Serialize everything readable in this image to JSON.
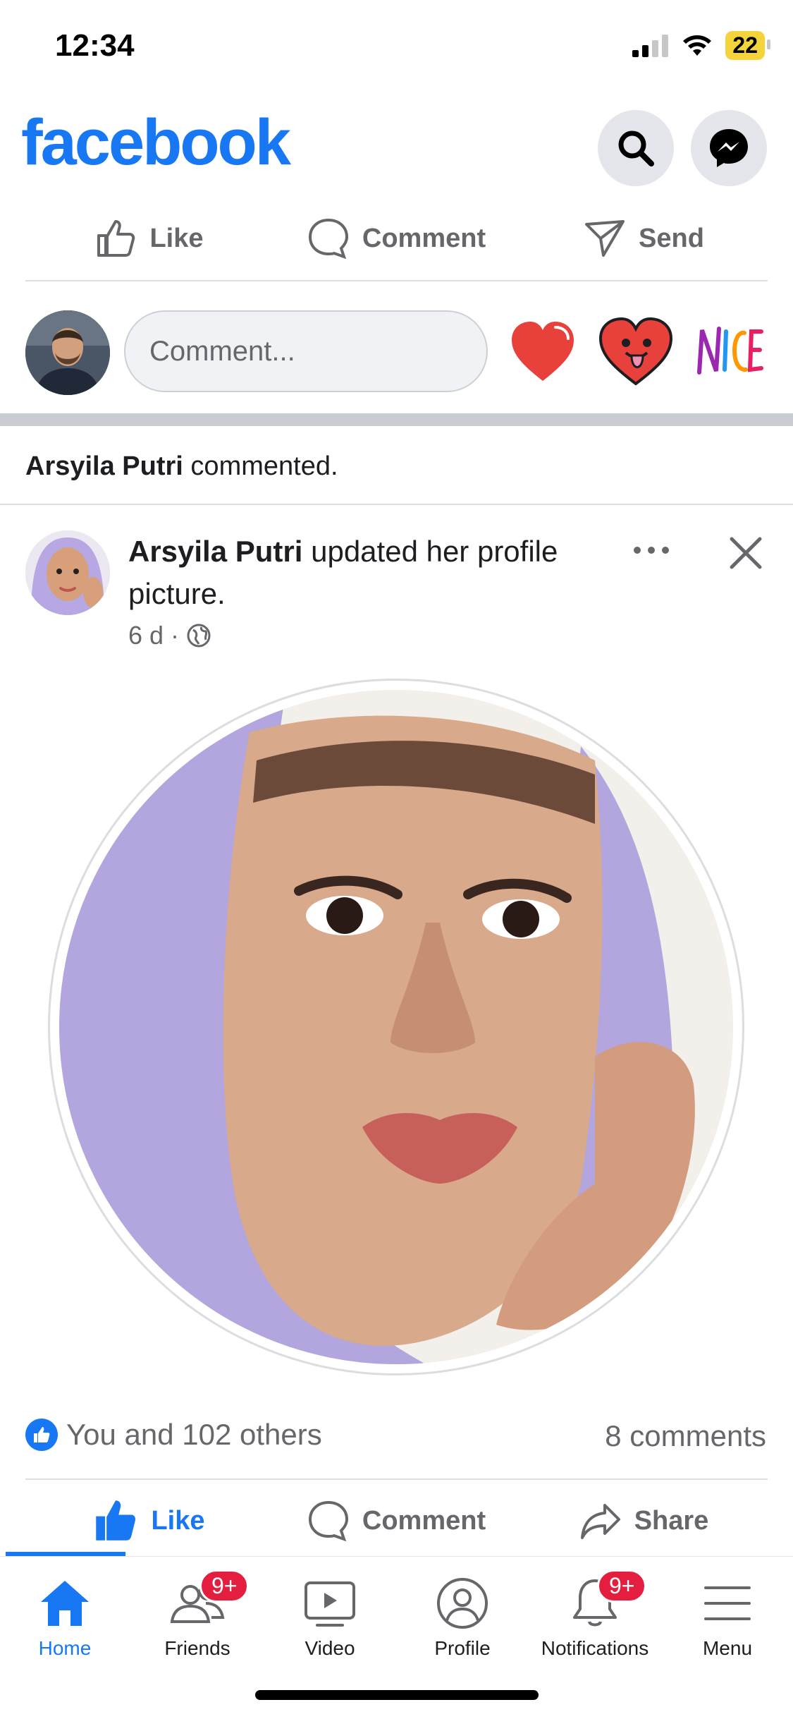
{
  "status_bar": {
    "time": "12:34",
    "battery": "22"
  },
  "header": {
    "brand": "facebook"
  },
  "top_actions": {
    "like": "Like",
    "comment": "Comment",
    "send": "Send"
  },
  "composer": {
    "placeholder": "Comment..."
  },
  "activity": {
    "name": "Arsyila Putri",
    "text": " commented."
  },
  "post": {
    "author": "Arsyila Putri",
    "action_text": " updated her profile picture.",
    "time": "6 d",
    "separator": "·",
    "privacy_icon": "globe-icon",
    "reactions_text": "You and 102 others",
    "comments_count": "8 comments"
  },
  "post_actions": {
    "like": "Like",
    "comment": "Comment",
    "share": "Share"
  },
  "tabs": [
    {
      "label": "Home",
      "icon": "home-icon",
      "badge": ""
    },
    {
      "label": "Friends",
      "icon": "friends-icon",
      "badge": "9+"
    },
    {
      "label": "Video",
      "icon": "video-icon",
      "badge": ""
    },
    {
      "label": "Profile",
      "icon": "profile-icon",
      "badge": ""
    },
    {
      "label": "Notifications",
      "icon": "bell-icon",
      "badge": "9+"
    },
    {
      "label": "Menu",
      "icon": "menu-icon",
      "badge": ""
    }
  ],
  "colors": {
    "brand": "#1877f2",
    "badge": "#e41e3f",
    "secondary_text": "#65676b"
  }
}
